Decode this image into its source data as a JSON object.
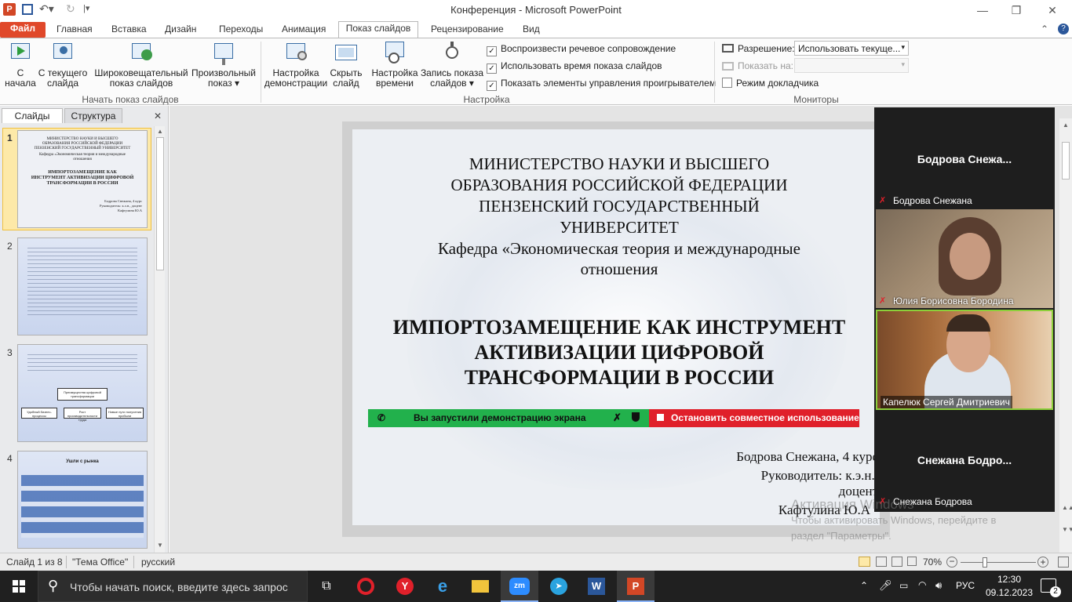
{
  "window": {
    "title": "Конференция  -  Microsoft PowerPoint",
    "min": "—",
    "max": "❐",
    "close": "✕"
  },
  "tabs": [
    "Файл",
    "Главная",
    "Вставка",
    "Дизайн",
    "Переходы",
    "Анимация",
    "Показ слайдов",
    "Рецензирование",
    "Вид"
  ],
  "ribbon": {
    "start_group": {
      "label": "Начать показ слайдов",
      "buttons": [
        {
          "line1": "С",
          "line2": "начала"
        },
        {
          "line1": "С текущего",
          "line2": "слайда"
        },
        {
          "line1": "Широковещательный",
          "line2": "показ слайдов"
        },
        {
          "line1": "Произвольный",
          "line2": "показ ▾"
        }
      ]
    },
    "setup_group": {
      "label": "Настройка",
      "buttons": [
        {
          "line1": "Настройка",
          "line2": "демонстрации"
        },
        {
          "line1": "Скрыть",
          "line2": "слайд"
        },
        {
          "line1": "Настройка",
          "line2": "времени"
        },
        {
          "line1": "Запись показа",
          "line2": "слайдов ▾"
        }
      ],
      "checks": [
        {
          "label": "Воспроизвести речевое сопровождение",
          "checked": true
        },
        {
          "label": "Использовать время показа слайдов",
          "checked": true
        },
        {
          "label": "Показать элементы управления проигрывателем",
          "checked": true
        }
      ]
    },
    "monitors_group": {
      "label": "Мониторы",
      "resolution_label": "Разрешение:",
      "resolution_value": "Использовать текуще...",
      "show_on_label": "Показать на:",
      "presenter_label": "Режим докладчика",
      "presenter_checked": false
    }
  },
  "leftpane": {
    "tab_slides": "Слайды",
    "tab_outline": "Структура",
    "close": "✕",
    "slide_numbers": [
      "1",
      "2",
      "3",
      "4"
    ],
    "thumb1": {
      "header": "МИНИСТЕРСТВО НАУКИ И ВЫСШЕГО ОБРАЗОВАНИЯ РОССИЙСКОЙ ФЕДЕРАЦИИ ПЕНЗЕНСКИЙ ГОСУДАРСТВЕННЫЙ УНИВЕРСИТЕТ",
      "dept": "Кафедра «Экономическая теория и международные отношения",
      "title": "ИМПОРТОЗАМЕЩЕНИЕ КАК ИНСТРУМЕНТ АКТИВИЗАЦИИ ЦИФРОВОЙ ТРАНСФОРМАЦИИ В РОССИИ",
      "author": "Бодрова Снежана, 4 курс Руководитель: к.э.н., доцент Кафтулина Ю.А"
    },
    "thumb3": {
      "box1": "Преимущества цифровой трансформации",
      "box2": "Удобный бизнес-процессы",
      "box3": "Рост производительности труда",
      "box4": "Новые пути получения прибыли"
    },
    "thumb4": {
      "title": "Ушли с рынка"
    }
  },
  "slide": {
    "line1": "МИНИСТЕРСТВО  НАУКИ И ВЫСШЕГО",
    "line2": "ОБРАЗОВАНИЯ  РОССИЙСКОЙ  ФЕДЕРАЦИИ",
    "line3": "ПЕНЗЕНСКИЙ  ГОСУДАРСТВЕННЫЙ",
    "line4": "УНИВЕРСИТЕТ",
    "line5": "Кафедра «Экономическая теория и международные",
    "line6": "отношения",
    "title1": "ИМПОРТОЗАМЕЩЕНИЕ  КАК ИНСТРУМЕНТ",
    "title2": "АКТИВИЗАЦИИ  ЦИФРОВОЙ",
    "title3": "ТРАНСФОРМАЦИИ  В РОССИИ",
    "author1": "Бодрова Снежана, 4 курс",
    "author2": "Руководитель: к.э.н.,",
    "author3": "доцент",
    "author4": "Кафтулина Ю.А"
  },
  "share_bar": {
    "status": "Вы запустили демонстрацию экрана",
    "stop": "Остановить совместное использование"
  },
  "zoom": {
    "participants": [
      {
        "tile_name": "Бодрова  Снежа...",
        "label": "Бодрова Снежана",
        "video": false
      },
      {
        "label": "Юлия Борисовна Бородина",
        "video": true
      },
      {
        "label": "Капелюк Сергей Дмитриевич",
        "video": true
      },
      {
        "tile_name": "Снежана  Бодро...",
        "label": "Снежана Бодрова",
        "video": false
      }
    ]
  },
  "watermark": {
    "line1": "Активация Windows",
    "line2": "Чтобы активировать Windows, перейдите в",
    "line3": "раздел \"Параметры\"."
  },
  "status": {
    "slide": "Слайд 1 из 8",
    "theme": "\"Тема Office\"",
    "lang": "русский",
    "zoom": "70%"
  },
  "taskbar": {
    "search": "Чтобы начать поиск, введите здесь запрос",
    "lang": "РУС",
    "time": "12:30",
    "date": "09.12.2023",
    "notif": "2"
  },
  "colors": {
    "file_tab": "#e0482a",
    "zoom_green": "#22b14c",
    "zoom_red": "#e0202a",
    "taskbar": "#202020"
  }
}
